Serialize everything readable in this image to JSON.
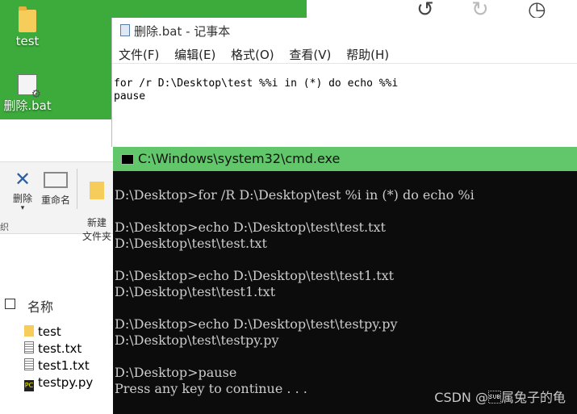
{
  "desktop": {
    "icons": [
      {
        "label": "test",
        "type": "folder"
      },
      {
        "label": "删除.bat",
        "type": "bat"
      }
    ]
  },
  "explorer": {
    "ribbon": {
      "delete_label": "删除",
      "rename_label": "重命名",
      "new_folder_label": "新建\n文件夹",
      "group_label": "织"
    },
    "column_name": "名称",
    "files": [
      {
        "name": "test",
        "type": "folder"
      },
      {
        "name": "test.txt",
        "type": "txt"
      },
      {
        "name": "test1.txt",
        "type": "txt"
      },
      {
        "name": "testpy.py",
        "type": "py"
      }
    ]
  },
  "notepad": {
    "title": "删除.bat - 记事本",
    "menu": [
      "文件(F)",
      "编辑(E)",
      "格式(O)",
      "查看(V)",
      "帮助(H)"
    ],
    "content": "for /r D:\\Desktop\\test %%i in (*) do echo %%i\npause"
  },
  "cmd": {
    "title": "C:\\Windows\\system32\\cmd.exe",
    "output": "D:\\Desktop>for /R D:\\Desktop\\test %i in (*) do echo %i\n\nD:\\Desktop>echo D:\\Desktop\\test\\test.txt\nD:\\Desktop\\test\\test.txt\n\nD:\\Desktop>echo D:\\Desktop\\test\\test1.txt\nD:\\Desktop\\test\\test1.txt\n\nD:\\Desktop>echo D:\\Desktop\\test\\testpy.py\nD:\\Desktop\\test\\testpy.py\n\nD:\\Desktop>pause\nPress any key to continue . . ."
  },
  "watermark": "CSDN @\u001a属兔子的龟",
  "colors": {
    "desktop_bg": "#3cab3b",
    "cmd_title_bg": "#62c66a",
    "cmd_bg": "#0c0c0c"
  },
  "icons": [
    "undo-icon",
    "redo-icon",
    "history-icon"
  ]
}
